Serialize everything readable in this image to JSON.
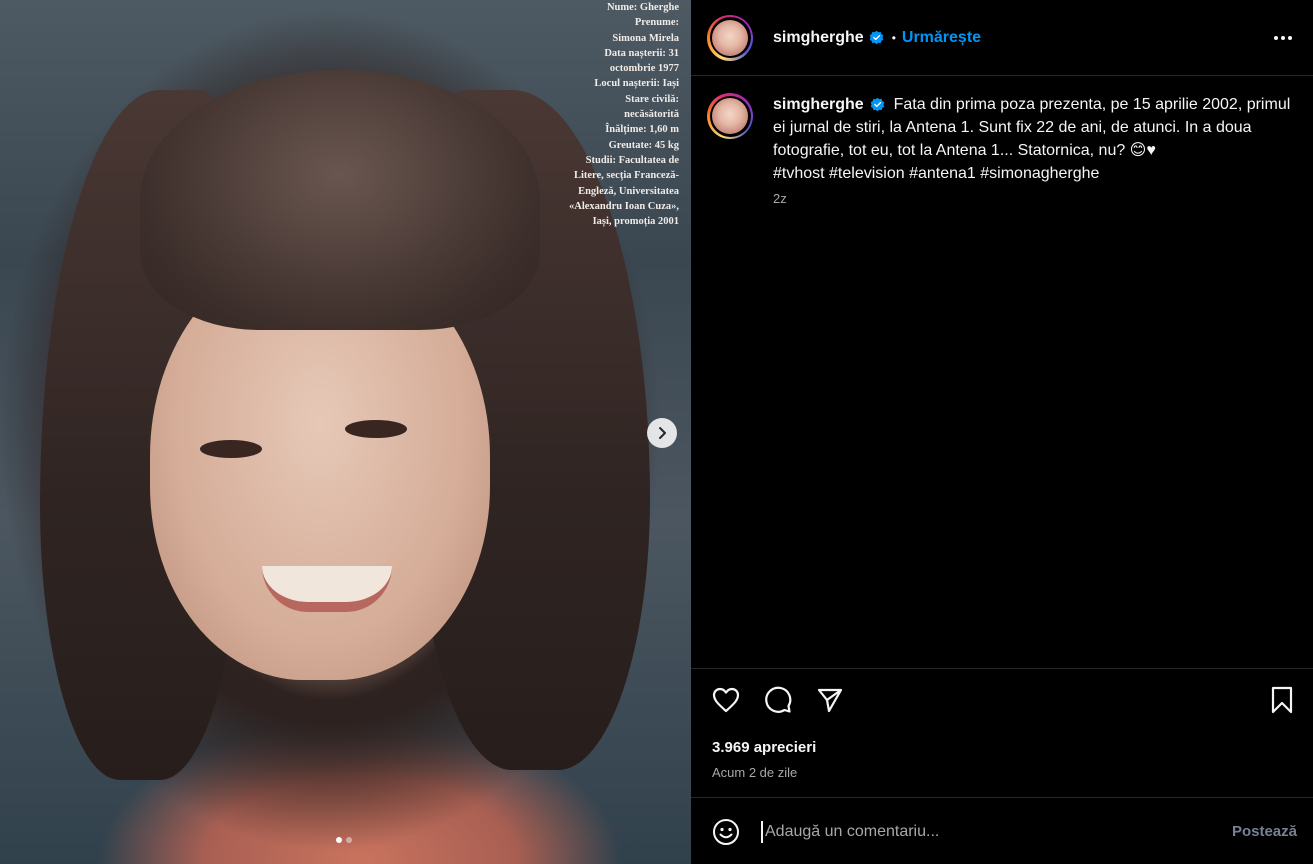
{
  "post_image": {
    "caption_lines": [
      "Nume: Gherghe",
      "Prenume:",
      "Simona Mirela",
      "Data nașterii: 31",
      "octombrie 1977",
      "Locul nașterii: Iași",
      "Stare civilă:",
      "necăsătorită",
      "Înălțime: 1,60 m",
      "Greutate: 45 kg",
      "Studii: Facultatea de",
      "Litere, secția Franceză-",
      "Engleză, Universitatea",
      "«Alexandru Ioan Cuza»,",
      "Iași, promoția 2001"
    ],
    "slide_count": 2,
    "active_slide": 1,
    "next_icon": "chevron-right-icon"
  },
  "header": {
    "username": "simgherghe",
    "verified_icon": "verified-badge-icon",
    "bullet": "•",
    "follow_label": "Urmărește",
    "more_icon": "more-options-icon"
  },
  "caption": {
    "username": "simgherghe",
    "text": "Fata din prima poza prezenta, pe 15 aprilie 2002, primul ei jurnal de stiri, la Antena 1. Sunt fix 22 de ani, de atunci. In a doua fotografie, tot eu, tot la Antena 1... Statornica, nu? 😊♥",
    "hashtags": "#tvhost #television #antena1 #simonagherghe",
    "time_ago": "2z"
  },
  "actions": {
    "like_icon": "heart-icon",
    "comment_icon": "comment-icon",
    "share_icon": "share-icon",
    "save_icon": "bookmark-icon",
    "likes": "3.969 aprecieri",
    "date": "Acum 2 de zile"
  },
  "comment_box": {
    "emoji_icon": "emoji-icon",
    "placeholder": "Adaugă un comentariu...",
    "post_label": "Postează"
  },
  "colors": {
    "background": "#000000",
    "follow": "#0095f6",
    "divider": "#262626",
    "muted": "#a8a8a8"
  }
}
